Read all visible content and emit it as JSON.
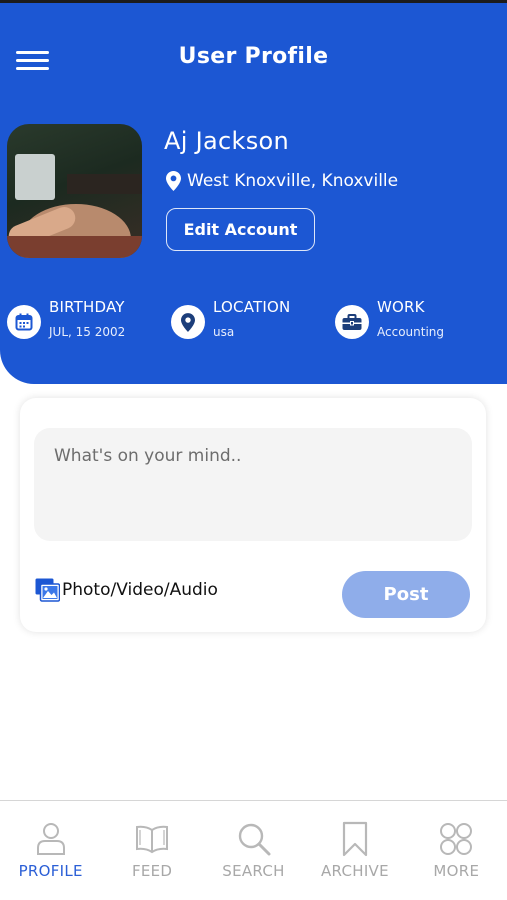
{
  "colors": {
    "brand_blue": "#1c57d3",
    "post_button": "#8fadea",
    "nav_active": "#2b5fd6",
    "nav_inactive": "#a8a8a8"
  },
  "header": {
    "title": "User Profile",
    "menu_icon": "hamburger-menu-icon"
  },
  "profile": {
    "name": "Aj Jackson",
    "location": "West Knoxville, Knoxville",
    "edit_button": "Edit Account"
  },
  "info": {
    "birthday": {
      "label": "BIRTHDAY",
      "value": "JUL, 15 2002",
      "icon": "calendar-icon"
    },
    "location": {
      "label": "LOCATION",
      "value": "usa",
      "icon": "map-pin-icon"
    },
    "work": {
      "label": "WORK",
      "value": "Accounting",
      "icon": "briefcase-icon"
    }
  },
  "composer": {
    "placeholder": "What's on your mind..",
    "media_label": "Photo/Video/Audio",
    "post_button": "Post"
  },
  "nav": {
    "items": [
      {
        "label": "PROFILE",
        "icon": "profile-icon",
        "active": true
      },
      {
        "label": "FEED",
        "icon": "book-icon",
        "active": false
      },
      {
        "label": "SEARCH",
        "icon": "search-icon",
        "active": false
      },
      {
        "label": "ARCHIVE",
        "icon": "bookmark-icon",
        "active": false
      },
      {
        "label": "MORE",
        "icon": "grid-icon",
        "active": false
      }
    ]
  }
}
